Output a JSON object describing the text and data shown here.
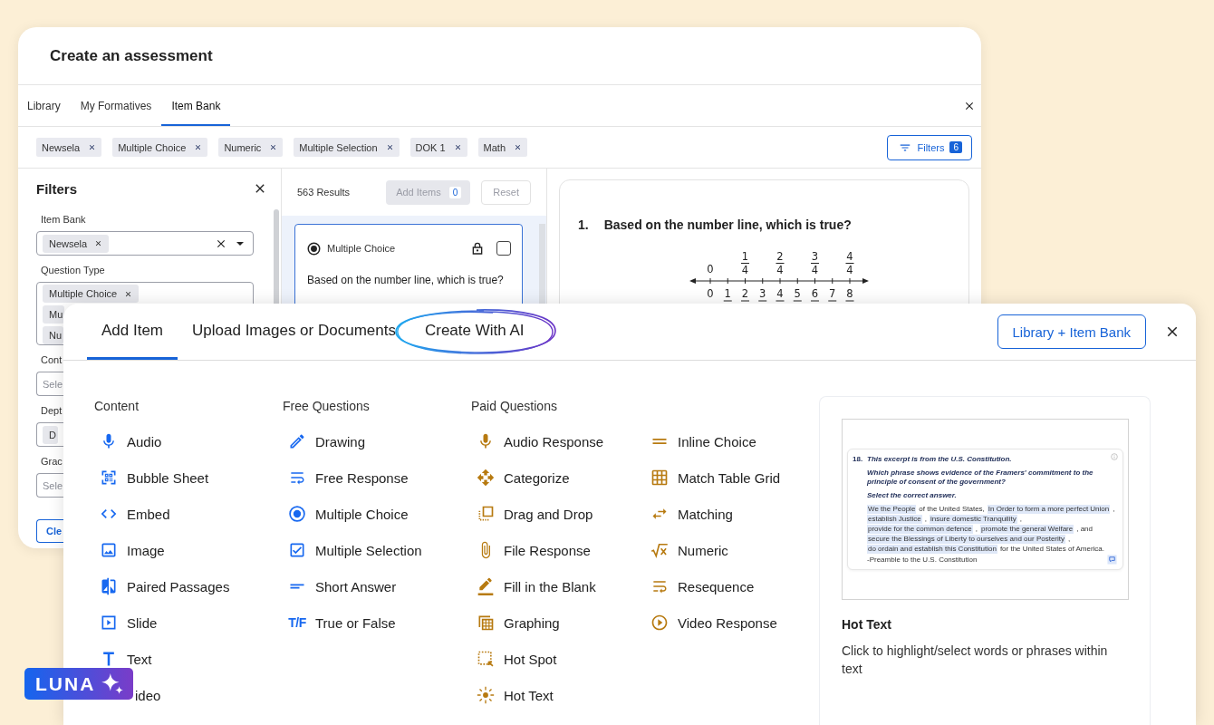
{
  "back_window": {
    "title": "Create an assessment",
    "tabs": [
      {
        "label": "Library",
        "selected": false
      },
      {
        "label": "My Formatives",
        "selected": false
      },
      {
        "label": "Item Bank",
        "selected": true
      }
    ],
    "filter_chips": [
      "Newsela",
      "Multiple Choice",
      "Numeric",
      "Multiple Selection",
      "DOK 1",
      "Math"
    ],
    "filters_button": {
      "label": "Filters",
      "count": "6"
    },
    "filters_panel": {
      "title": "Filters",
      "fields": [
        {
          "label": "Item Bank",
          "kind": "select",
          "chips": [
            {
              "label": "Newsela",
              "removable": true
            }
          ],
          "clearable": true,
          "dropdown": true
        },
        {
          "label": "Question Type",
          "kind": "multi",
          "chips": [
            {
              "label": "Multiple Choice",
              "removable": true
            },
            {
              "label": "Mu"
            },
            {
              "label": "Nu"
            }
          ]
        },
        {
          "label": "Cont",
          "kind": "select",
          "placeholder": "Sele"
        },
        {
          "label": "Dept",
          "kind": "select",
          "chips": [
            {
              "label": "D"
            }
          ]
        },
        {
          "label": "Grac",
          "kind": "select",
          "placeholder": "Sele"
        }
      ],
      "clear_button": "Cle"
    },
    "results": {
      "count": "563 Results",
      "add_button": {
        "label": "Add Items",
        "count": "0",
        "disabled": true
      },
      "reset_button": "Reset",
      "card": {
        "type": "Multiple Choice",
        "locked": true,
        "checked": false,
        "question": "Based on the number line, which is true?"
      }
    },
    "preview": {
      "number": "1.",
      "question": "Based on the number line, which is true?",
      "number_line": {
        "top_labels": [
          {
            "kind": "whole",
            "text": "0"
          },
          {
            "kind": "fraction",
            "numerator": "1",
            "denominator": "4"
          },
          {
            "kind": "fraction",
            "numerator": "2",
            "denominator": "4"
          },
          {
            "kind": "fraction",
            "numerator": "3",
            "denominator": "4"
          },
          {
            "kind": "fraction",
            "numerator": "4",
            "denominator": "4"
          }
        ],
        "bottom_labels": [
          {
            "kind": "whole",
            "text": "0"
          },
          {
            "kind": "fraction",
            "numerator": "1"
          },
          {
            "kind": "fraction",
            "numerator": "2"
          },
          {
            "kind": "fraction",
            "numerator": "3"
          },
          {
            "kind": "fraction",
            "numerator": "4"
          },
          {
            "kind": "fraction",
            "numerator": "5"
          },
          {
            "kind": "fraction",
            "numerator": "6"
          },
          {
            "kind": "fraction",
            "numerator": "7"
          },
          {
            "kind": "fraction",
            "numerator": "8"
          }
        ]
      }
    }
  },
  "add_panel": {
    "tabs": [
      {
        "label": "Add Item",
        "selected": true,
        "highlighted": false
      },
      {
        "label": "Upload Images or Documents",
        "selected": false,
        "highlighted": false
      },
      {
        "label": "Create With AI",
        "selected": false,
        "highlighted": true
      }
    ],
    "library_button": "Library + Item Bank",
    "sections": [
      {
        "title": "Content",
        "paid": false,
        "columns": [
          [
            {
              "label": "Audio",
              "kind": "audio"
            },
            {
              "label": "Bubble Sheet",
              "kind": "bubblesheet"
            },
            {
              "label": "Embed",
              "kind": "embed"
            },
            {
              "label": "Image",
              "kind": "image"
            },
            {
              "label": "Paired Passages",
              "kind": "passages"
            },
            {
              "label": "Slide",
              "kind": "slide"
            },
            {
              "label": "Text",
              "kind": "text"
            },
            {
              "label": "ideo"
            }
          ]
        ]
      },
      {
        "title": "Free Questions",
        "paid": false,
        "columns": [
          [
            {
              "label": "Drawing",
              "kind": "drawing"
            },
            {
              "label": "Free Response",
              "kind": "freeresponse"
            },
            {
              "label": "Multiple Choice",
              "kind": "multiplechoice"
            },
            {
              "label": "Multiple Selection",
              "kind": "multipleselection"
            },
            {
              "label": "Short Answer",
              "kind": "shortanswer"
            },
            {
              "label": "True or False",
              "kind": "truefalse",
              "icon_text": "T/F"
            }
          ]
        ]
      },
      {
        "title": "Paid Questions",
        "paid": true,
        "columns": [
          [
            {
              "label": "Audio Response",
              "kind": "audioresponse"
            },
            {
              "label": "Categorize",
              "kind": "categorize"
            },
            {
              "label": "Drag and Drop",
              "kind": "draganddrop"
            },
            {
              "label": "File Response",
              "kind": "fileresponse"
            },
            {
              "label": "Fill in the Blank",
              "kind": "fillblank"
            },
            {
              "label": "Graphing",
              "kind": "graphing"
            },
            {
              "label": "Hot Spot",
              "kind": "hotspot"
            },
            {
              "label": "Hot Text",
              "kind": "hottext"
            }
          ],
          [
            {
              "label": "Inline Choice",
              "kind": "inlinechoice"
            },
            {
              "label": "Match Table Grid",
              "kind": "matchtable"
            },
            {
              "label": "Matching",
              "kind": "matching"
            },
            {
              "label": "Numeric",
              "kind": "numeric"
            },
            {
              "label": "Resequence",
              "kind": "resequence"
            },
            {
              "label": "Video Response",
              "kind": "videoresponse"
            }
          ]
        ]
      }
    ],
    "preview": {
      "thumbnail": {
        "number": "18.",
        "prompt": [
          "This excerpt is from the U.S. Constitution.",
          "Which phrase shows evidence of the Framers' commitment to the principle of consent of the government?",
          "Select the correct answer."
        ],
        "passage": [
          {
            "text": "We the People",
            "highlighted": true
          },
          {
            "text": "of the United States,",
            "highlighted": false
          },
          {
            "text": "In Order to form a more perfect Union",
            "highlighted": true
          },
          {
            "text": ",",
            "highlighted": false
          },
          {
            "text": "establish Justice",
            "highlighted": true
          },
          {
            "text": ",",
            "highlighted": false
          },
          {
            "text": "insure domestic Tranquility",
            "highlighted": true
          },
          {
            "text": ",",
            "highlighted": false
          },
          {
            "text": "provide for the common defence",
            "highlighted": true
          },
          {
            "text": ",",
            "highlighted": false
          },
          {
            "text": "promote the general Welfare",
            "highlighted": true
          },
          {
            "text": ", and",
            "highlighted": false
          },
          {
            "text": "secure the Blessings of Liberty to ourselves and our Posterity",
            "highlighted": true
          },
          {
            "text": ",",
            "highlighted": false
          },
          {
            "text": "do ordain and establish this Constitution",
            "highlighted": true
          },
          {
            "text": "for the United States of America.",
            "highlighted": false
          }
        ],
        "source": "-Preamble to the U.S. Constitution"
      },
      "title": "Hot Text",
      "description": "Click to highlight/select words or phrases within text"
    }
  },
  "badge": {
    "label": "LUNA"
  }
}
